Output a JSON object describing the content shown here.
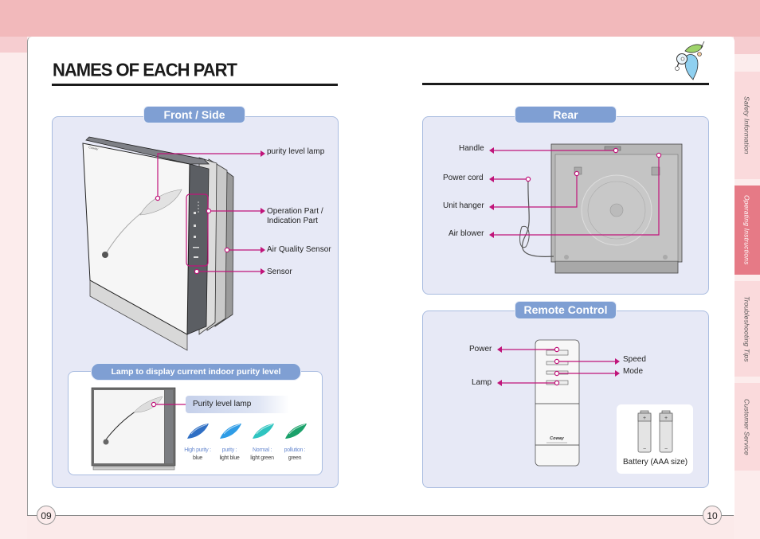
{
  "header": {
    "title": "NAMES OF EACH PART"
  },
  "side_tabs": [
    {
      "label": "Safety Information",
      "active": false
    },
    {
      "label": "Operating Instructions",
      "active": true
    },
    {
      "label": "Troubleshooting Tips",
      "active": false
    },
    {
      "label": "Customer Service",
      "active": false
    }
  ],
  "front_side": {
    "title": "Front / Side",
    "brand": "Coway",
    "callouts": [
      {
        "label": "purity level lamp"
      },
      {
        "label_line1": "Operation Part /",
        "label_line2": "Indication Part"
      },
      {
        "label": "Air Quality Sensor"
      },
      {
        "label": "Sensor"
      }
    ]
  },
  "lamp_panel": {
    "title": "Lamp to display current indoor purity level",
    "tag": "Purity level lamp",
    "levels": [
      {
        "state": "High purity :",
        "color_name": "blue",
        "color": "#2f6fc4"
      },
      {
        "state": "purity :",
        "color_name": "light blue",
        "color": "#2e9ce6"
      },
      {
        "state": "Normal :",
        "color_name": "light green",
        "color": "#2fc4c0"
      },
      {
        "state": "pollution :",
        "color_name": "green",
        "color": "#1aa16a"
      }
    ]
  },
  "rear": {
    "title": "Rear",
    "callouts": [
      {
        "label": "Handle"
      },
      {
        "label": "Power cord"
      },
      {
        "label": "Unit hanger"
      },
      {
        "label": "Air blower"
      }
    ]
  },
  "remote": {
    "title": "Remote Control",
    "brand": "Coway",
    "callouts_left": [
      {
        "label": "Power"
      },
      {
        "label": "Lamp"
      }
    ],
    "callouts_right": [
      {
        "label": "Speed"
      },
      {
        "label": "Mode"
      }
    ],
    "battery_label": "Battery (AAA size)"
  },
  "footer": {
    "page_left": "09",
    "page_right": "10"
  },
  "colors": {
    "accent_magenta": "#c0147a",
    "panel_title_blue": "#7f9fd3",
    "active_tab": "#e67a86"
  }
}
